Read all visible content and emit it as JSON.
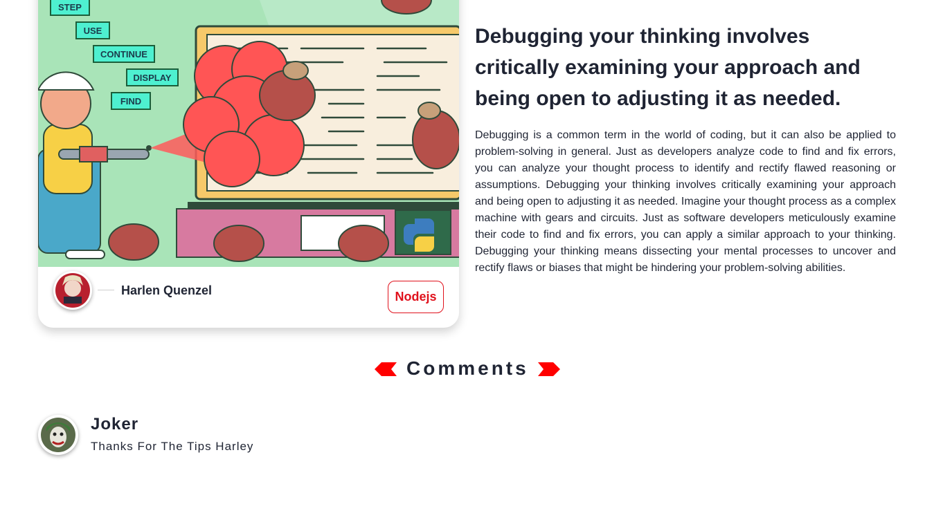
{
  "post": {
    "illustration_labels": [
      "STEP",
      "USE",
      "CONTINUE",
      "DISPLAY",
      "FIND"
    ],
    "author": {
      "name": "Harlen Quenzel"
    },
    "tag": {
      "label": "Nodejs"
    },
    "title": "Debugging your thinking involves critically examining your approach and being open to adjusting it as needed.",
    "body": "Debugging is a common term in the world of coding, but it can also be applied to problem-solving in general. Just as developers analyze code to find and fix errors, you can analyze your thought process to identify and rectify flawed reasoning or assumptions. Debugging your thinking involves critically examining your approach and being open to adjusting it as needed. Imagine your thought process as a complex machine with gears and circuits. Just as software developers meticulously examine their code to find and fix errors, you can apply a similar approach to your thinking. Debugging your thinking means dissecting your mental processes to uncover and rectify flaws or biases that might be hindering your problem-solving abilities."
  },
  "comments": {
    "heading": "Comments",
    "items": [
      {
        "author": "Joker",
        "text": "Thanks For The Tips Harley"
      }
    ]
  },
  "colors": {
    "accent": "#e0111c",
    "text": "#1f2433",
    "illustration_bg": "#a9e4b8",
    "label_box": "#4ef0d0"
  }
}
